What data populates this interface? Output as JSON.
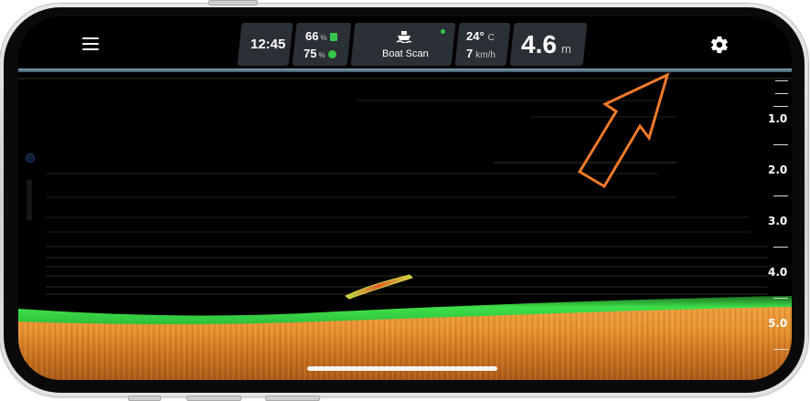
{
  "status": {
    "time": "12:45",
    "battery_1": {
      "value": "66",
      "unit": "%",
      "icon": "battery-icon"
    },
    "battery_2": {
      "value": "75",
      "unit": "%",
      "icon": "sonar-battery-icon"
    },
    "mode_label": "Boat Scan",
    "mode_icon": "boat-icon",
    "connection_color": "#2ecc40",
    "temperature": {
      "value": "24°",
      "unit": "C"
    },
    "speed": {
      "value": "7",
      "unit": "km/h"
    },
    "depth": {
      "value": "4.6",
      "unit": "m"
    }
  },
  "toolbar": {
    "menu_icon": "hamburger-menu-icon",
    "settings_icon": "gear-icon"
  },
  "depth_scale": {
    "labels": [
      "1.0",
      "2.0",
      "3.0",
      "4.0",
      "5.0"
    ]
  },
  "annotation": {
    "icon": "orange-arrow-icon",
    "color": "#f07a2a"
  },
  "colors": {
    "bottom_green": "#35d84a",
    "bottom_orange": "#e89a3a",
    "panel_bg": "#2b3036"
  }
}
